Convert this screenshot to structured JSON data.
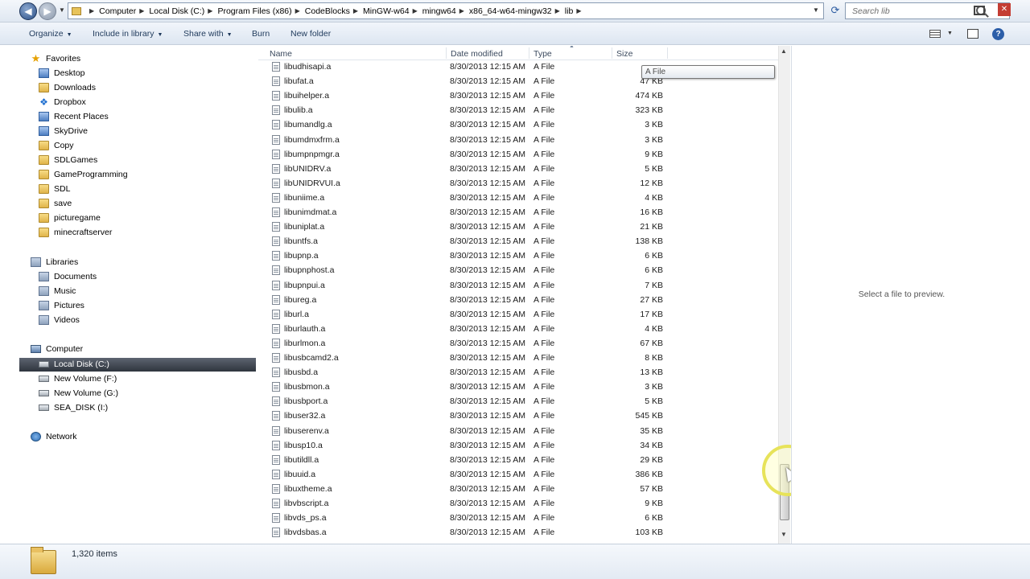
{
  "address_bar": {
    "crumbs": [
      "Computer",
      "Local Disk (C:)",
      "Program Files (x86)",
      "CodeBlocks",
      "MinGW-w64",
      "mingw64",
      "x86_64-w64-mingw32",
      "lib"
    ],
    "search_placeholder": "Search lib"
  },
  "toolbar": {
    "organize": "Organize",
    "include": "Include in library",
    "share": "Share with",
    "burn": "Burn",
    "new_folder": "New folder"
  },
  "nav": {
    "favorites": "Favorites",
    "desktop": "Desktop",
    "downloads": "Downloads",
    "dropbox": "Dropbox",
    "recent": "Recent Places",
    "skydrive": "SkyDrive",
    "copy": "Copy",
    "sdlgames": "SDLGames",
    "gameprog": "GameProgramming",
    "sdl": "SDL",
    "save": "save",
    "picturegame": "picturegame",
    "minecraft": "minecraftserver",
    "libraries": "Libraries",
    "documents": "Documents",
    "music": "Music",
    "pictures": "Pictures",
    "videos": "Videos",
    "computer": "Computer",
    "localdisk": "Local Disk (C:)",
    "newvol_f": "New Volume (F:)",
    "newvol_g": "New Volume (G:)",
    "seadisk": "SEA_DISK (I:)",
    "network": "Network"
  },
  "columns": {
    "name": "Name",
    "date": "Date modified",
    "type": "Type",
    "size": "Size"
  },
  "tooltip": "A File",
  "files": [
    {
      "name": "libudhisapi.a",
      "date": "8/30/2013 12:15 AM",
      "type": "A File",
      "size": ""
    },
    {
      "name": "libufat.a",
      "date": "8/30/2013 12:15 AM",
      "type": "A File",
      "size": "47 KB"
    },
    {
      "name": "libuihelper.a",
      "date": "8/30/2013 12:15 AM",
      "type": "A File",
      "size": "474 KB"
    },
    {
      "name": "libulib.a",
      "date": "8/30/2013 12:15 AM",
      "type": "A File",
      "size": "323 KB"
    },
    {
      "name": "libumandlg.a",
      "date": "8/30/2013 12:15 AM",
      "type": "A File",
      "size": "3 KB"
    },
    {
      "name": "libumdmxfrm.a",
      "date": "8/30/2013 12:15 AM",
      "type": "A File",
      "size": "3 KB"
    },
    {
      "name": "libumpnpmgr.a",
      "date": "8/30/2013 12:15 AM",
      "type": "A File",
      "size": "9 KB"
    },
    {
      "name": "libUNIDRV.a",
      "date": "8/30/2013 12:15 AM",
      "type": "A File",
      "size": "5 KB"
    },
    {
      "name": "libUNIDRVUI.a",
      "date": "8/30/2013 12:15 AM",
      "type": "A File",
      "size": "12 KB"
    },
    {
      "name": "libuniime.a",
      "date": "8/30/2013 12:15 AM",
      "type": "A File",
      "size": "4 KB"
    },
    {
      "name": "libunimdmat.a",
      "date": "8/30/2013 12:15 AM",
      "type": "A File",
      "size": "16 KB"
    },
    {
      "name": "libuniplat.a",
      "date": "8/30/2013 12:15 AM",
      "type": "A File",
      "size": "21 KB"
    },
    {
      "name": "libuntfs.a",
      "date": "8/30/2013 12:15 AM",
      "type": "A File",
      "size": "138 KB"
    },
    {
      "name": "libupnp.a",
      "date": "8/30/2013 12:15 AM",
      "type": "A File",
      "size": "6 KB"
    },
    {
      "name": "libupnphost.a",
      "date": "8/30/2013 12:15 AM",
      "type": "A File",
      "size": "6 KB"
    },
    {
      "name": "libupnpui.a",
      "date": "8/30/2013 12:15 AM",
      "type": "A File",
      "size": "7 KB"
    },
    {
      "name": "libureg.a",
      "date": "8/30/2013 12:15 AM",
      "type": "A File",
      "size": "27 KB"
    },
    {
      "name": "liburl.a",
      "date": "8/30/2013 12:15 AM",
      "type": "A File",
      "size": "17 KB"
    },
    {
      "name": "liburlauth.a",
      "date": "8/30/2013 12:15 AM",
      "type": "A File",
      "size": "4 KB"
    },
    {
      "name": "liburlmon.a",
      "date": "8/30/2013 12:15 AM",
      "type": "A File",
      "size": "67 KB"
    },
    {
      "name": "libusbcamd2.a",
      "date": "8/30/2013 12:15 AM",
      "type": "A File",
      "size": "8 KB"
    },
    {
      "name": "libusbd.a",
      "date": "8/30/2013 12:15 AM",
      "type": "A File",
      "size": "13 KB"
    },
    {
      "name": "libusbmon.a",
      "date": "8/30/2013 12:15 AM",
      "type": "A File",
      "size": "3 KB"
    },
    {
      "name": "libusbport.a",
      "date": "8/30/2013 12:15 AM",
      "type": "A File",
      "size": "5 KB"
    },
    {
      "name": "libuser32.a",
      "date": "8/30/2013 12:15 AM",
      "type": "A File",
      "size": "545 KB"
    },
    {
      "name": "libuserenv.a",
      "date": "8/30/2013 12:15 AM",
      "type": "A File",
      "size": "35 KB"
    },
    {
      "name": "libusp10.a",
      "date": "8/30/2013 12:15 AM",
      "type": "A File",
      "size": "34 KB"
    },
    {
      "name": "libutildll.a",
      "date": "8/30/2013 12:15 AM",
      "type": "A File",
      "size": "29 KB"
    },
    {
      "name": "libuuid.a",
      "date": "8/30/2013 12:15 AM",
      "type": "A File",
      "size": "386 KB"
    },
    {
      "name": "libuxtheme.a",
      "date": "8/30/2013 12:15 AM",
      "type": "A File",
      "size": "57 KB"
    },
    {
      "name": "libvbscript.a",
      "date": "8/30/2013 12:15 AM",
      "type": "A File",
      "size": "9 KB"
    },
    {
      "name": "libvds_ps.a",
      "date": "8/30/2013 12:15 AM",
      "type": "A File",
      "size": "6 KB"
    },
    {
      "name": "libvdsbas.a",
      "date": "8/30/2013 12:15 AM",
      "type": "A File",
      "size": "103 KB"
    }
  ],
  "preview": {
    "message": "Select a file to preview."
  },
  "details": {
    "item_count": "1,320 items"
  }
}
